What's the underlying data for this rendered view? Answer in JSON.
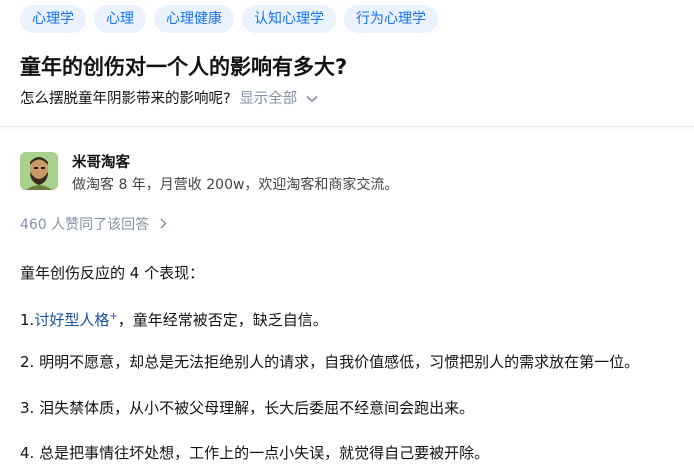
{
  "tags": [
    "心理学",
    "心理",
    "心理健康",
    "认知心理学",
    "行为心理学"
  ],
  "question": {
    "title": "童年的创伤对一个人的影响有多大?",
    "detail": "怎么摆脱童年阴影带来的影响呢?",
    "show_all": "显示全部"
  },
  "author": {
    "name": "米哥淘客",
    "bio": "做淘客 8 年，月营收 200w，欢迎淘客和商家交流。"
  },
  "answer": {
    "votes_text": "460 人赞同了该回答",
    "intro": "童年创伤反应的 4 个表现：",
    "p1_prefix": "1.",
    "p1_link": "讨好型人格",
    "p1_sup": "+",
    "p1_suffix": "，童年经常被否定，缺乏自信。",
    "p2": "2. 明明不愿意，却总是无法拒绝别人的请求，自我价值感低，习惯把别人的需求放在第一位。",
    "p3": "3. 泪失禁体质，从小不被父母理解，长大后委屈不经意间会跑出来。",
    "p4": "4. 总是把事情往坏处想，工作上的一点小失误，就觉得自己要被开除。"
  },
  "colors": {
    "tag_bg": "#eaf2ff",
    "tag_text": "#1772f6",
    "link": "#175199",
    "muted": "#8590a6"
  }
}
